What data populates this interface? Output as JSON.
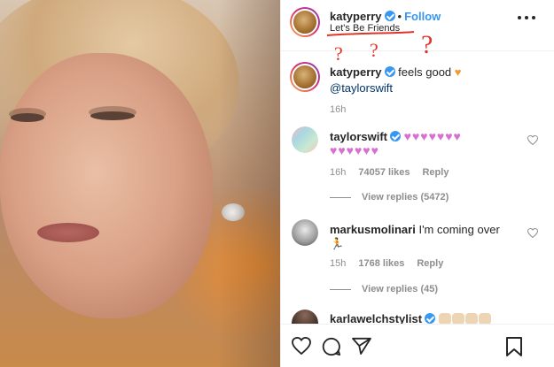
{
  "post": {
    "username": "katyperry",
    "follow_label": "Follow",
    "dot": "•",
    "location": "Let's Be Friends",
    "annotation_marks": [
      "?",
      "?",
      "?"
    ]
  },
  "comments": [
    {
      "username": "katyperry",
      "text": "feels good",
      "emoji": "♥",
      "mention": "@taylorswift",
      "time": "16h"
    },
    {
      "username": "taylorswift",
      "hearts_line1": "♥♥♥♥♥♥♥",
      "hearts_line2": "♥♥♥♥♥♥",
      "time": "16h",
      "likes": "74057 likes",
      "reply": "Reply",
      "view_replies": "View replies (5472)"
    },
    {
      "username": "markusmolinari",
      "text": "I'm coming over",
      "emoji": "🏃",
      "time": "15h",
      "likes": "1768 likes",
      "reply": "Reply",
      "view_replies": "View replies (45)"
    },
    {
      "username": "karlawelchstylist"
    }
  ],
  "colors": {
    "verified": "#3897f0",
    "follow": "#3897f0",
    "annotation": "#e0342b",
    "text": "#262626",
    "muted": "#8e8e8e"
  },
  "icons": {
    "more": "more-horizontal-icon",
    "like": "heart-outline-icon",
    "comment": "speech-bubble-icon",
    "share": "paper-plane-icon",
    "save": "bookmark-icon"
  }
}
